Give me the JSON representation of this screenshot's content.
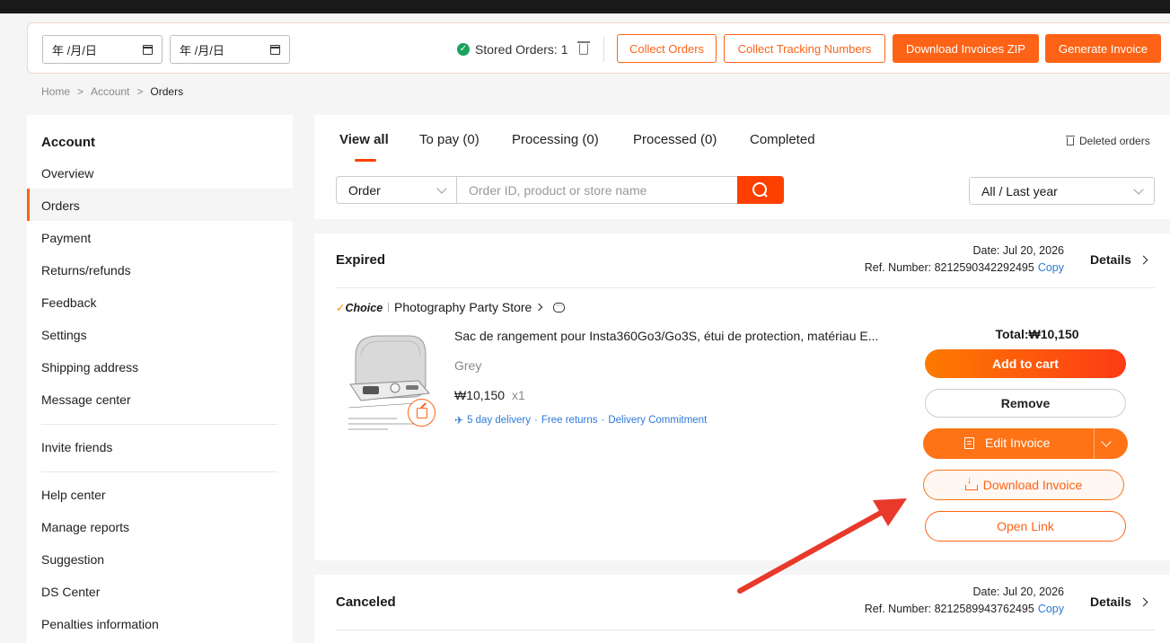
{
  "toolbar": {
    "date_from_placeholder": "年 /月/日",
    "date_to_placeholder": "年 /月/日",
    "stored_orders": "Stored Orders: 1",
    "collect_orders": "Collect Orders",
    "collect_tracking": "Collect Tracking Numbers",
    "download_zip": "Download Invoices ZIP",
    "generate_invoice": "Generate Invoice"
  },
  "breadcrumb": {
    "home": "Home",
    "account": "Account",
    "current": "Orders",
    "sep": ">"
  },
  "sidebar": {
    "title": "Account",
    "items": [
      "Overview",
      "Orders",
      "Payment",
      "Returns/refunds",
      "Feedback",
      "Settings",
      "Shipping address",
      "Message center"
    ],
    "items2": [
      "Invite friends"
    ],
    "items3": [
      "Help center",
      "Manage reports",
      "Suggestion",
      "DS Center",
      "Penalties information"
    ]
  },
  "tabs": {
    "items": [
      "View all",
      "To pay (0)",
      "Processing (0)",
      "Processed (0)",
      "Completed"
    ],
    "deleted_orders": "Deleted orders"
  },
  "search": {
    "type": "Order",
    "placeholder": "Order ID, product or store name",
    "filter": "All / Last year"
  },
  "orders": [
    {
      "status": "Expired",
      "date": "Date: Jul 20, 2026",
      "ref": "Ref. Number: 8212590342292495",
      "copy": "Copy",
      "details": "Details",
      "choice_label": "Choice",
      "store": "Photography Party Store",
      "product_title": "Sac de rangement pour Insta360Go3/Go3S, étui de protection, matériau E...",
      "variant": "Grey",
      "price": "₩10,150",
      "qty": "x1",
      "delivery": [
        "5 day delivery",
        "Free returns",
        "Delivery Commitment"
      ],
      "total": "Total:₩10,150",
      "buttons": {
        "add_to_cart": "Add to cart",
        "remove": "Remove",
        "edit_invoice": "Edit Invoice",
        "download_invoice": "Download Invoice",
        "open_link": "Open Link"
      }
    },
    {
      "status": "Canceled",
      "date": "Date: Jul 20, 2026",
      "ref": "Ref. Number: 8212589943762495",
      "copy": "Copy",
      "details": "Details"
    }
  ],
  "colors": {
    "accent": "#fd6316",
    "link": "#2d7ad6",
    "annotation_arrow": "#e8392b"
  }
}
